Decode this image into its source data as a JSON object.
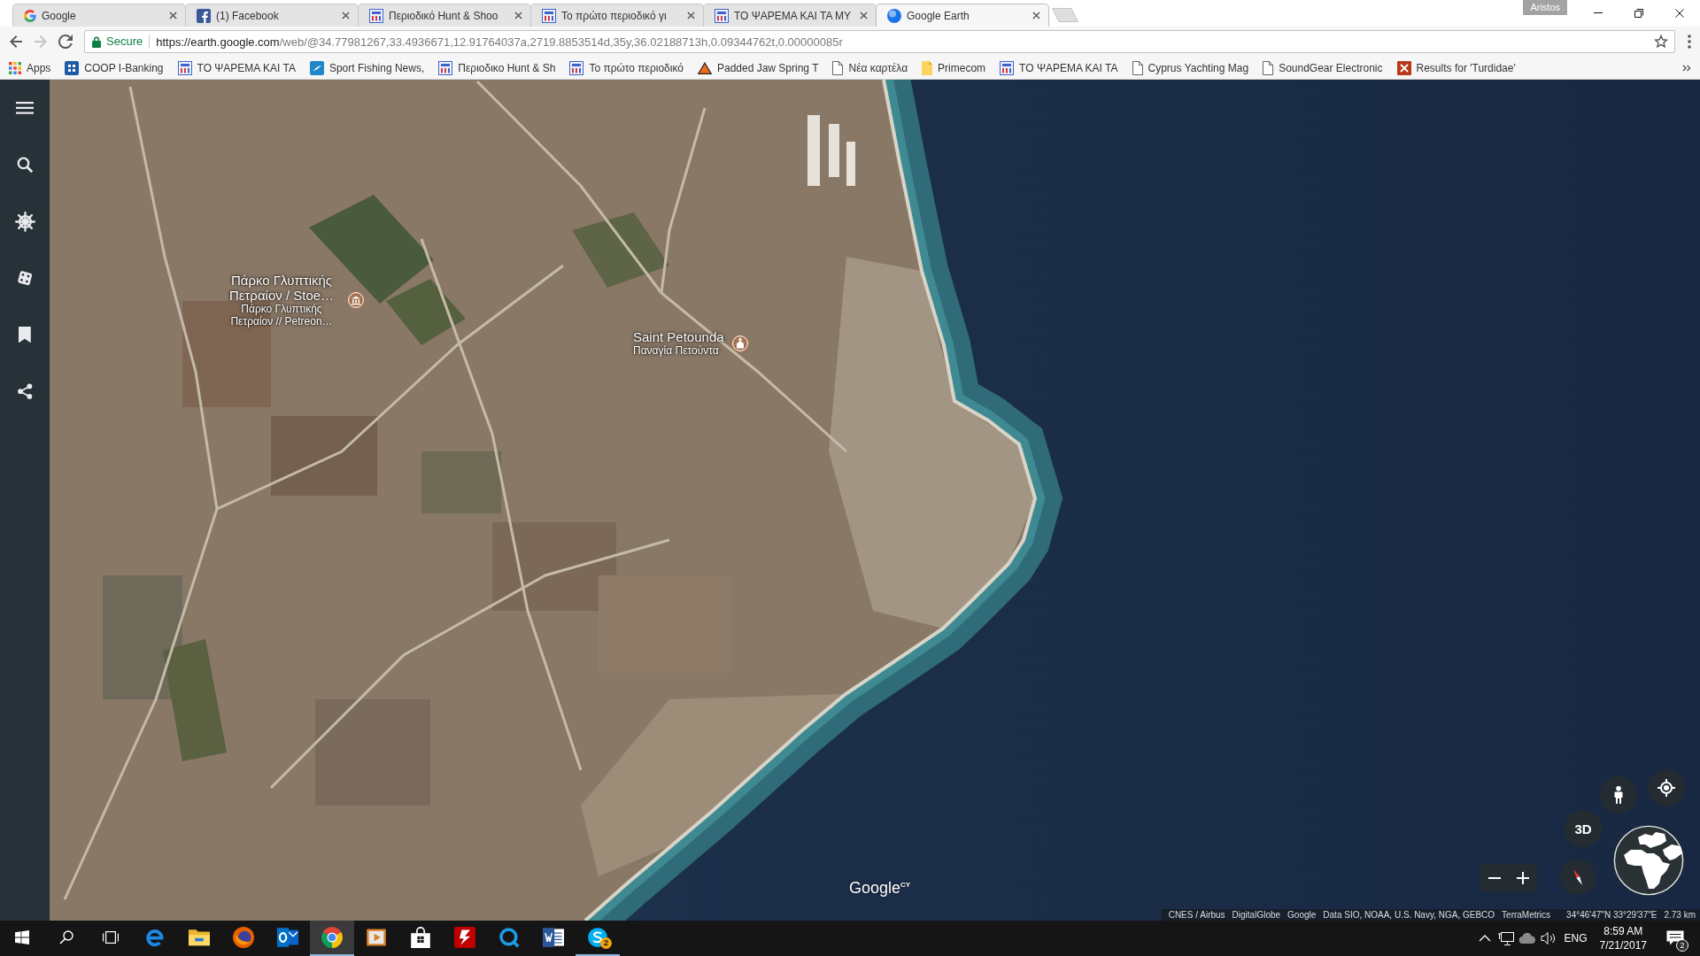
{
  "browser": {
    "tabs": [
      {
        "title": "Google",
        "kind": "google",
        "selected": false
      },
      {
        "title": "(1) Facebook",
        "kind": "facebook",
        "selected": false
      },
      {
        "title": "Περιοδικό Hunt & Shoo",
        "kind": "magazine",
        "selected": false
      },
      {
        "title": "Το πρώτο περιοδικό γι",
        "kind": "magazine",
        "selected": false
      },
      {
        "title": "ΤΟ ΨΑΡΕΜΑ ΚΑΙ ΤΑ ΜΥ",
        "kind": "magazine",
        "selected": false
      },
      {
        "title": "Google Earth",
        "kind": "earth",
        "selected": true
      }
    ],
    "profile": "Aristos",
    "toolbar": {
      "back_disabled": false,
      "forward_disabled": true
    },
    "address_bar": {
      "security": "Secure",
      "url_origin": "https://earth.google.com",
      "url_path": "/web/@34.77981267,33.4936671,12.91764037a,2719.8853514d,35y,36.02188713h,0.09344762t,0.00000085r"
    },
    "bookmarks": [
      {
        "label": "Apps",
        "kind": "apps"
      },
      {
        "label": "COOP I-Banking",
        "kind": "coop"
      },
      {
        "label": "ΤΟ ΨΑΡΕΜΑ ΚΑΙ ΤΑ",
        "kind": "magazine"
      },
      {
        "label": "Sport Fishing News,",
        "kind": "sf"
      },
      {
        "label": "Περιοδικο Hunt & Sh",
        "kind": "magazine"
      },
      {
        "label": "Το πρώτο περιοδικό",
        "kind": "magazine"
      },
      {
        "label": "Padded Jaw Spring T",
        "kind": "triangle"
      },
      {
        "label": "Νέα καρτέλα",
        "kind": "page"
      },
      {
        "label": "Primecom",
        "kind": "note"
      },
      {
        "label": "ΤΟ ΨΑΡΕΜΑ ΚΑΙ ΤΑ",
        "kind": "magazine"
      },
      {
        "label": "Cyprus Yachting Mag",
        "kind": "page"
      },
      {
        "label": "SoundGear Electronic",
        "kind": "page"
      },
      {
        "label": "Results for 'Turdidae'",
        "kind": "xc"
      }
    ]
  },
  "earth": {
    "sidebar": [
      {
        "kind": "menu"
      },
      {
        "kind": "search"
      },
      {
        "kind": "voyager"
      },
      {
        "kind": "dice"
      },
      {
        "kind": "bookmark"
      },
      {
        "kind": "share"
      }
    ],
    "places": [
      {
        "kind": "museum",
        "name": "Πάρκο Γλυπτικής Πετραίον / Stoe…",
        "subtitle": "Πάρκο Γλυπτικής Πετραίον // Petreon…"
      },
      {
        "kind": "church",
        "name": "Saint Petounda",
        "subtitle": "Παναγία Πετούντα"
      }
    ],
    "logo": "Google$^{CY}$",
    "controls": {
      "view_mode": "3D"
    },
    "attribution": [
      "CNES / Airbus",
      "DigitalGlobe",
      "Google",
      "Data SIO, NOAA, U.S. Navy, NGA, GEBCO",
      "TerraMetrics"
    ],
    "coordinates": "34°46'47\"N 33°29'37\"E",
    "scale": "2.73 km"
  },
  "taskbar": {
    "buttons": [
      {
        "kind": "start"
      },
      {
        "kind": "search"
      },
      {
        "kind": "task_view"
      }
    ],
    "apps": [
      {
        "kind": "edge",
        "running": false,
        "selected": false
      },
      {
        "kind": "explorer",
        "running": false,
        "selected": false
      },
      {
        "kind": "firefox",
        "running": false,
        "selected": false
      },
      {
        "kind": "outlook",
        "running": false,
        "selected": false
      },
      {
        "kind": "chrome",
        "running": true,
        "selected": true
      },
      {
        "kind": "media",
        "running": false,
        "selected": false
      },
      {
        "kind": "store",
        "running": false,
        "selected": false
      },
      {
        "kind": "filezilla",
        "running": false,
        "selected": false
      },
      {
        "kind": "ring",
        "running": false,
        "selected": false
      },
      {
        "kind": "word",
        "running": false,
        "selected": false
      },
      {
        "kind": "skype",
        "running": true,
        "selected": false,
        "badge": "2"
      }
    ],
    "tray": {
      "icons": [
        {
          "kind": "chevron"
        },
        {
          "kind": "network"
        },
        {
          "kind": "cloud"
        },
        {
          "kind": "volume"
        }
      ],
      "language": "ENG",
      "time": "8:59 AM",
      "date": "7/21/2017",
      "notifications": "2"
    }
  }
}
